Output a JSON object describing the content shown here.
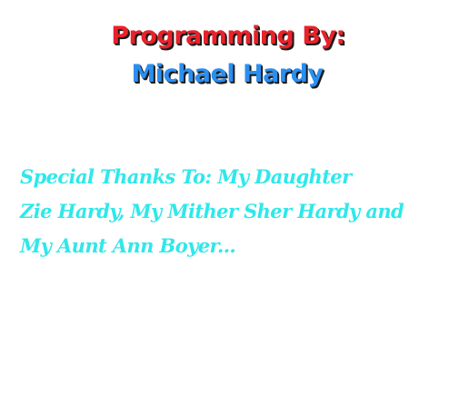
{
  "credits": {
    "programming_label": "Programming By:",
    "author": "Michael Hardy",
    "thanks_lines": [
      "Special Thanks To: My Daughter",
      "Zie Hardy, My Mither Sher Hardy and",
      "My Aunt Ann Boyer..."
    ]
  },
  "colors": {
    "heading_red": "#e8222b",
    "name_blue": "#2a8ff0",
    "thanks_cyan": "#2ee8ea",
    "background": "#ffffff"
  }
}
